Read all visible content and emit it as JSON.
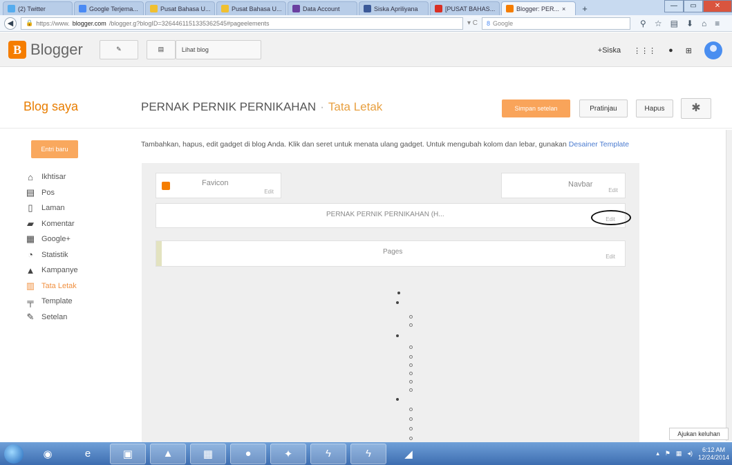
{
  "browser": {
    "tabs": [
      {
        "label": "(2) Twitter",
        "color": "#55acee",
        "icon": "twitter-icon"
      },
      {
        "label": "Google Terjema...",
        "color": "#4a8af4",
        "icon": "translate-icon"
      },
      {
        "label": "Pusat Bahasa U...",
        "color": "#f0c030",
        "icon": "page-icon"
      },
      {
        "label": "Pusat Bahasa U...",
        "color": "#f0c030",
        "icon": "page-icon"
      },
      {
        "label": "Data Account",
        "color": "#6a3fa0",
        "icon": "yahoo-icon"
      },
      {
        "label": "Siska Apriliyana",
        "color": "#3b5998",
        "icon": "facebook-icon"
      },
      {
        "label": "[PUSAT BAHAS...",
        "color": "#d93025",
        "icon": "gmail-icon"
      },
      {
        "label": "Blogger: PER...",
        "color": "#f57d00",
        "icon": "blogger-icon",
        "active": true
      }
    ],
    "new_tab": "+",
    "url_prefix": "https://www.",
    "url_domain": "blogger.com",
    "url_rest": "/blogger.g?blogID=3264461151335362545#pageelements",
    "search_placeholder": "Google"
  },
  "header": {
    "logo_letter": "B",
    "app_name": "Blogger",
    "view_blog": "Lihat blog",
    "user": "+Siska"
  },
  "titlebar": {
    "blog_saya": "Blog saya",
    "blog_name": "PERNAK PERNIK PERNIKAHAN",
    "separator": "·",
    "section": "Tata Letak",
    "save": "Simpan setelan",
    "preview": "Pratinjau",
    "delete": "Hapus"
  },
  "sidebar": {
    "new_post": "Entri baru",
    "items": [
      {
        "label": "Ikhtisar",
        "icon": "home-icon",
        "glyph": "⌂"
      },
      {
        "label": "Pos",
        "icon": "posts-icon",
        "glyph": "▤"
      },
      {
        "label": "Laman",
        "icon": "pages-icon",
        "glyph": "▯"
      },
      {
        "label": "Komentar",
        "icon": "comment-icon",
        "glyph": "▰"
      },
      {
        "label": "Google+",
        "icon": "google-plus-icon",
        "glyph": "▦"
      },
      {
        "label": "Statistik",
        "icon": "stats-icon",
        "glyph": "◔"
      },
      {
        "label": "Kampanye",
        "icon": "campaign-icon",
        "glyph": "▲"
      },
      {
        "label": "Tata Letak",
        "icon": "layout-icon",
        "glyph": "▥",
        "active": true
      },
      {
        "label": "Template",
        "icon": "template-icon",
        "glyph": "╤"
      },
      {
        "label": "Setelan",
        "icon": "wrench-icon",
        "glyph": "✎"
      }
    ]
  },
  "main": {
    "hint_text": "Tambahkan, hapus, edit gadget di blog Anda. Klik dan seret untuk menata ulang gadget. Untuk mengubah kolom dan lebar, gunakan ",
    "hint_link": "Desainer Template",
    "favicon_label": "Favicon",
    "favicon_edit": "Edit",
    "navbar_label": "Navbar",
    "navbar_edit": "Edit",
    "header_label": "PERNAK PERNIK PERNIKAHAN (H...",
    "header_edit": "Edit",
    "pages_label": "Pages",
    "pages_edit": "Edit"
  },
  "tooltip": "Ajukan keluhan",
  "taskbar": {
    "apps": [
      "◉",
      "e",
      "▣",
      "▲",
      "▦",
      "●",
      "✦",
      "ϟ",
      "ϟ",
      "◢"
    ],
    "time": "6:12 AM",
    "date": "12/24/2014"
  }
}
